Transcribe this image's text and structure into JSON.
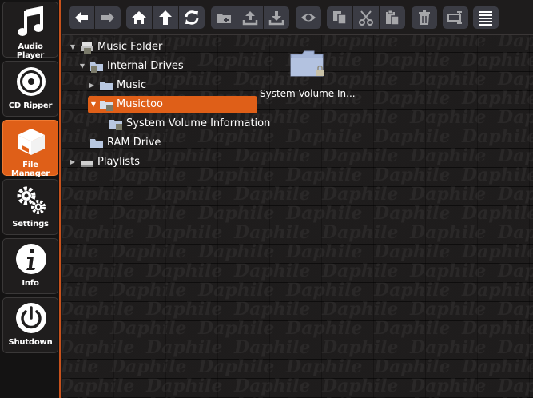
{
  "nav": [
    {
      "label": "Audio Player",
      "icon": "music-note-icon",
      "active": false
    },
    {
      "label": "CD Ripper",
      "icon": "cd-icon",
      "active": false
    },
    {
      "label": "File Manager",
      "icon": "box-icon",
      "active": true
    },
    {
      "label": "Settings",
      "icon": "gears-icon",
      "active": false
    },
    {
      "label": "Info",
      "icon": "info-icon",
      "active": false
    },
    {
      "label": "Shutdown",
      "icon": "power-icon",
      "active": false
    }
  ],
  "tree": {
    "music_folder": "Music Folder",
    "internal_drives": "Internal Drives",
    "music": "Music",
    "musictoo": "Musictoo",
    "system_volume": "System Volume Information",
    "ram_drive": "RAM Drive",
    "playlists": "Playlists"
  },
  "files": [
    {
      "name": "System Volume In..."
    }
  ],
  "watermark": "Daphile",
  "colors": {
    "accent": "#df5f18",
    "toolbar_button": "#3b3c44",
    "folder": "#9fb3d6"
  }
}
